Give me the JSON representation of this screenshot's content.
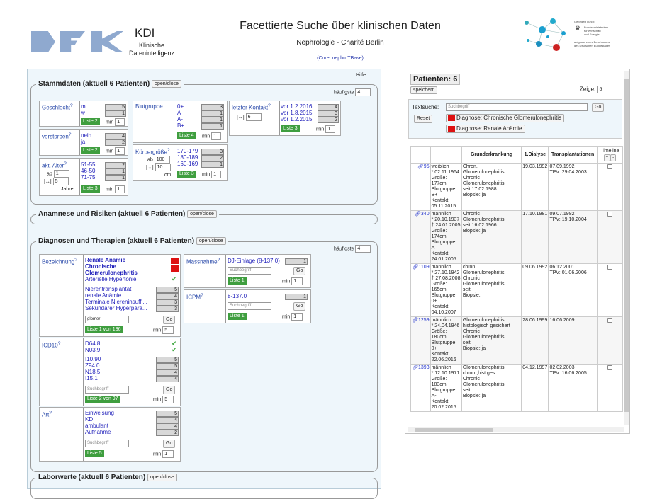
{
  "header": {
    "kdi": "KDI",
    "kdi_sub1": "Klinische",
    "kdi_sub2": "Datenintelligenz",
    "title": "Facettierte Suche über klinischen Daten",
    "subtitle": "Nephrologie - Charité Berlin",
    "core": "(Core: nephroTBase)",
    "bmwi_l1": "Gefördert durch:",
    "bmwi_l2": "Bundesministerium",
    "bmwi_l3": "für Wirtschaft",
    "bmwi_l4": "und Energie",
    "bmwi_l5": "aufgrund eines Beschlusses",
    "bmwi_l6": "des Deutschen Bundestages"
  },
  "left": {
    "hilfe": "Hilfe",
    "stammdaten": {
      "legend": "Stammdaten (aktuell 6 Patienten)",
      "toggle": "open/close",
      "haeufigste_label": "häufigste",
      "haeufigste_val": "4",
      "geschlecht": {
        "title": "Geschlecht",
        "items": [
          {
            "label": "m",
            "count": "5"
          },
          {
            "label": "w",
            "count": "1"
          }
        ],
        "liste": "Liste 2",
        "min": "min",
        "min_val": "1"
      },
      "verstorben": {
        "title": "verstorben",
        "items": [
          {
            "label": "nein",
            "count": "4"
          },
          {
            "label": "ja",
            "count": "2"
          }
        ],
        "liste": "Liste 2",
        "min": "min",
        "min_val": "1"
      },
      "alter": {
        "title": "akt. Alter",
        "ab": "ab",
        "ab_val": "1",
        "range_val": "5",
        "jahre": "Jahre",
        "items": [
          {
            "label": "51-55",
            "count": "2"
          },
          {
            "label": "46-50",
            "count": "1"
          },
          {
            "label": "71-75",
            "count": "1"
          }
        ],
        "liste": "Liste 3",
        "min": "min",
        "min_val": "1"
      },
      "blutgruppe": {
        "title": "Blutgruppe",
        "items": [
          {
            "label": "0+",
            "count": "3"
          },
          {
            "label": "A",
            "count": "1"
          },
          {
            "label": "A-",
            "count": "1"
          },
          {
            "label": "B+",
            "count": "1"
          }
        ],
        "liste": "Liste 4",
        "min": "min",
        "min_val": "1"
      },
      "groesse": {
        "title": "Körpergröße",
        "ab": "ab",
        "ab_val": "100",
        "range_val": "10",
        "unit": "cm",
        "items": [
          {
            "label": "170-179",
            "count": "3"
          },
          {
            "label": "180-189",
            "count": "2"
          },
          {
            "label": "160-169",
            "count": "1"
          }
        ],
        "liste": "Liste 3",
        "min": "min",
        "min_val": "1"
      },
      "kontakt": {
        "title": "letzter Kontakt",
        "range_val": "6",
        "items": [
          {
            "label": "vor 1.2.2016",
            "count": "4"
          },
          {
            "label": "vor 1.8.2015",
            "count": "3"
          },
          {
            "label": "vor 1.2.2015",
            "count": "2"
          }
        ],
        "liste": "Liste 3",
        "min": "min",
        "min_val": "1"
      }
    },
    "anamnese": {
      "legend": "Anamnese und Risiken (aktuell 6 Patienten)",
      "toggle": "open/close"
    },
    "diagnosen": {
      "legend": "Diagnosen und Therapien (aktuell 6 Patienten)",
      "toggle": "open/close",
      "haeufigste_label": "häufigste",
      "haeufigste_val": "4",
      "bezeichnung": {
        "title": "Bezeichnung",
        "selected": [
          "Renale Anämie",
          "Chronische",
          "Glomerulonephritis"
        ],
        "checked": "Arterielle Hypertonie",
        "items": [
          {
            "label": "Nierentransplantat",
            "count": "5"
          },
          {
            "label": "renale Anämie",
            "count": "4"
          },
          {
            "label": "Terminale Niereninsuffi...",
            "count": "3"
          },
          {
            "label": "Sekundärer Hyperpara...",
            "count": "3"
          }
        ],
        "search_val": "glomer",
        "go": "Go",
        "liste": "Liste 1 von 136",
        "min": "min",
        "min_val": "5"
      },
      "icd": {
        "title": "ICD10",
        "checked": [
          "D64.8",
          "N03.9"
        ],
        "items": [
          {
            "label": "I10.90",
            "count": "5"
          },
          {
            "label": "Z94.0",
            "count": "5"
          },
          {
            "label": "N18.5",
            "count": "4"
          },
          {
            "label": "I15.1",
            "count": "4"
          }
        ],
        "search_ph": "Suchbegriff",
        "go": "Go",
        "liste": "Liste 2 von 97",
        "min": "min",
        "min_val": "5"
      },
      "art": {
        "title": "Art",
        "items": [
          {
            "label": "Einweisung",
            "count": "5"
          },
          {
            "label": "KD",
            "count": "4"
          },
          {
            "label": "ambulant",
            "count": "4"
          },
          {
            "label": "Aufnahme",
            "count": "2"
          }
        ],
        "search_ph": "Suchbegriff",
        "go": "Go",
        "liste": "Liste 5",
        "min": "min",
        "min_val": "1"
      },
      "massnahme": {
        "title": "Massnahme",
        "items": [
          {
            "label": "DJ-Einlage (8-137.0)",
            "count": "1"
          }
        ],
        "search_ph": "Suchbegriff",
        "go": "Go",
        "liste": "Liste 1",
        "min": "min",
        "min_val": "1"
      },
      "icpm": {
        "title": "ICPM",
        "items": [
          {
            "label": "8-137.0",
            "count": "1"
          }
        ],
        "search_ph": "Suchbegriff",
        "go": "Go",
        "liste": "Liste 1",
        "min": "min",
        "min_val": "1"
      }
    },
    "laborwerte": {
      "legend": "Laborwerte (aktuell 6 Patienten)",
      "toggle": "open/close"
    }
  },
  "right": {
    "title": "Patienten: 6",
    "save": "speichern",
    "zeige_label": "Zeige:",
    "zeige_val": "5",
    "textsuche": "Textsuche:",
    "search_ph": "Suchbegriff",
    "go": "Go",
    "reset": "Reset",
    "chips": [
      "Diagnose: Chronische Glomerulonephritis",
      "Diagnose: Renale Anämie"
    ],
    "columns": [
      "Grunderkrankung",
      "1.Dialyse",
      "Transplantationen",
      "Timeline"
    ],
    "rows": [
      {
        "id": "95",
        "info": [
          "weiblich",
          "* 02.11.1964",
          "Größe:",
          "177cm",
          "Blutgruppe:",
          "B+",
          "Kontakt:",
          "05.11.2015"
        ],
        "diag": [
          "Chron.",
          "Glomerulonephritis",
          "Chronic",
          "Glomerulonephritis",
          "seit 17.02.1988",
          "Biopsie: ja"
        ],
        "dialyse": "19.03.1992",
        "tx": [
          "07.09.1992",
          "TPV: 29.04.2003"
        ]
      },
      {
        "id": "340",
        "info": [
          "männlich",
          "* 20.10.1937",
          "† 24.01.2005",
          "Größe:",
          "174cm",
          "Blutgruppe:",
          "A",
          "Kontakt:",
          "24.01.2005"
        ],
        "diag": [
          "Chronic",
          "Glomerulonephritis",
          "seit 16.02.1966",
          "Biopsie: ja"
        ],
        "dialyse": "17.10.1981",
        "tx": [
          "09.07.1982",
          "TPV: 19.10.2004"
        ]
      },
      {
        "id": "1109",
        "info": [
          "männlich",
          "* 27.10.1942",
          "† 27.08.2008",
          "Größe:",
          "165cm",
          "Blutgruppe:",
          "0+",
          "Kontakt:",
          "04.10.2007"
        ],
        "diag": [
          "chron.",
          "Glomerulonephritis",
          "Chronic",
          "Glomerulonephritis",
          "seit",
          "Biopsie:"
        ],
        "dialyse": "09.06.1992",
        "tx": [
          "06.12.2001",
          "TPV: 01.06.2006"
        ]
      },
      {
        "id": "1259",
        "info": [
          "männlich",
          "* 24.04.1946",
          "Größe:",
          "180cm",
          "Blutgruppe:",
          "0+",
          "Kontakt:",
          "22.06.2016"
        ],
        "diag": [
          "Glomerulonephritis;",
          "histologisch gesichert",
          "Chronic",
          "Glomerulonephritis",
          "seit",
          "Biopsie: ja"
        ],
        "dialyse": "28.06.1999",
        "tx": [
          "16.06.2009"
        ]
      },
      {
        "id": "1393",
        "info": [
          "männlich",
          "* 12.10.1971",
          "Größe:",
          "183cm",
          "Blutgruppe:",
          "A-",
          "Kontakt:",
          "20.02.2015"
        ],
        "diag": [
          "Glomerulonephritis,",
          "chron.,hist ges",
          "Chronic",
          "Glomerulonephritis",
          "seit",
          "Biopsie: ja"
        ],
        "dialyse": "04.12.1997",
        "tx": [
          "02.02.2003",
          "TPV: 16.06.2005"
        ]
      }
    ]
  },
  "colors": {
    "accent_green": "#3f9e3f",
    "selected_red": "#dd1111",
    "link_blue": "#2222bb",
    "panel_bg": "#eef6fb"
  }
}
